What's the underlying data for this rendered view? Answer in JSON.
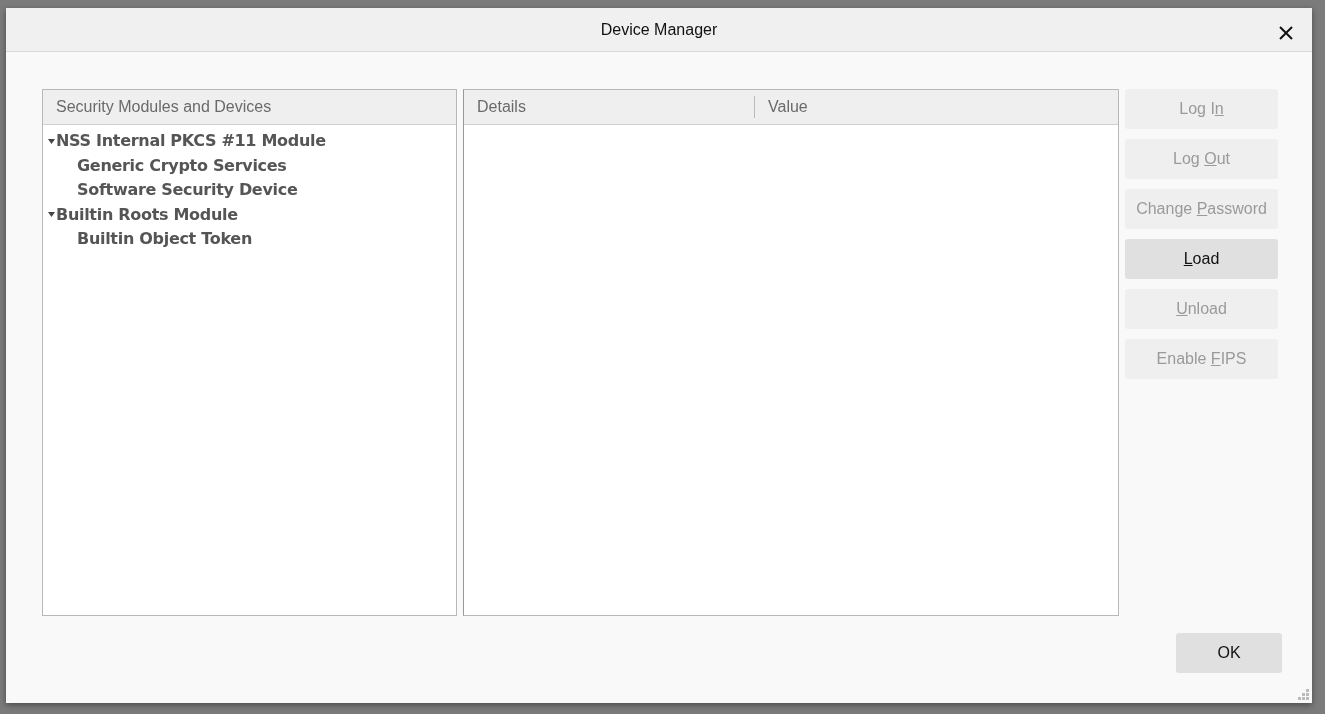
{
  "window": {
    "title": "Device Manager"
  },
  "tree": {
    "column": "Security Modules and Devices",
    "items": [
      {
        "label": "NSS Internal PKCS #11 Module",
        "expanded": true,
        "children": [
          {
            "label": "Generic Crypto Services"
          },
          {
            "label": "Software Security Device"
          }
        ]
      },
      {
        "label": "Builtin Roots Module",
        "expanded": true,
        "children": [
          {
            "label": "Builtin Object Token"
          }
        ]
      }
    ]
  },
  "details": {
    "columns": [
      "Details",
      "Value"
    ]
  },
  "buttons": [
    {
      "label_parts": [
        {
          "text": "Log I",
          "underlined": false
        },
        {
          "text": "n",
          "underlined": true
        }
      ],
      "disabled": true
    },
    {
      "label_parts": [
        {
          "text": "Log ",
          "underlined": false
        },
        {
          "text": "O",
          "underlined": true
        },
        {
          "text": "ut",
          "underlined": false
        }
      ],
      "disabled": true
    },
    {
      "label_parts": [
        {
          "text": "Change ",
          "underlined": false
        },
        {
          "text": "P",
          "underlined": true
        },
        {
          "text": "assword",
          "underlined": false
        }
      ],
      "disabled": true
    },
    {
      "label_parts": [
        {
          "text": "L",
          "underlined": true
        },
        {
          "text": "oad",
          "underlined": false
        }
      ],
      "disabled": false
    },
    {
      "label_parts": [
        {
          "text": "U",
          "underlined": true
        },
        {
          "text": "nload",
          "underlined": false
        }
      ],
      "disabled": true
    },
    {
      "label_parts": [
        {
          "text": "Enable ",
          "underlined": false
        },
        {
          "text": "F",
          "underlined": true
        },
        {
          "text": "IPS",
          "underlined": false
        }
      ],
      "disabled": true
    }
  ],
  "ok_button": {
    "label": "OK"
  }
}
